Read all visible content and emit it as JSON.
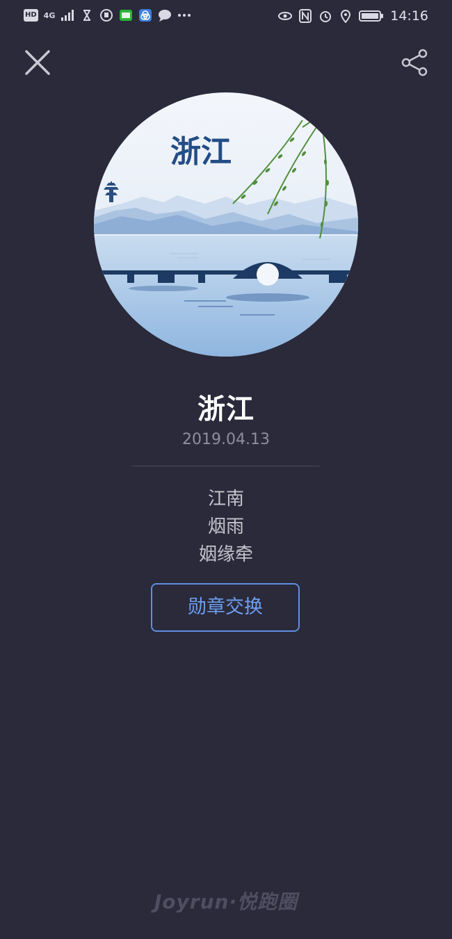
{
  "status_bar": {
    "hd": "HD",
    "network": "4G",
    "time": "14:16",
    "icons": [
      "hd-icon",
      "signal-icon",
      "hourglass-icon",
      "hand-icon",
      "iqiyi-icon",
      "app-icon",
      "chat-icon",
      "more-icon",
      "eye-icon",
      "nfc-icon",
      "alarm-icon",
      "location-icon",
      "battery-icon"
    ]
  },
  "top_bar": {
    "close_icon": "close-icon",
    "share_icon": "share-icon"
  },
  "medal": {
    "image_text": "浙江",
    "colors": {
      "sky": "#eaf1f9",
      "water": "#a9c7e6",
      "bridge": "#1c3a63",
      "willow": "#4f8f3b"
    }
  },
  "title": "浙江",
  "date": "2019.04.13",
  "description": [
    "江南",
    "烟雨",
    "姻缘牵"
  ],
  "exchange_button": "勋章交换",
  "brand": "Joyrun·悦跑圈",
  "accent_color": "#6c9ff0"
}
